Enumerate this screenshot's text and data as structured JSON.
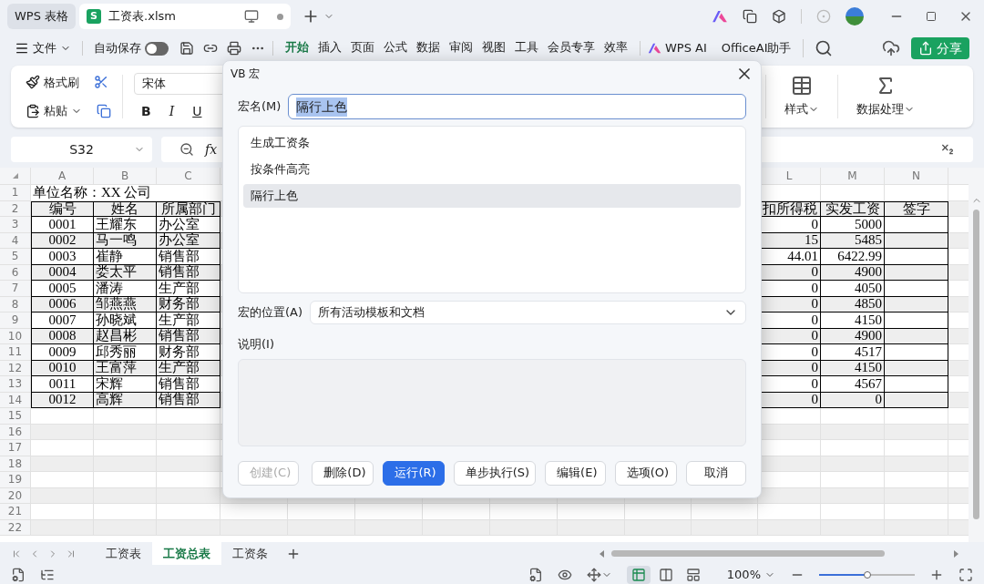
{
  "title_bar": {
    "app_tab": "WPS 表格",
    "document_tab": {
      "icon_letter": "S",
      "title": "工资表.xlsm",
      "selected": true
    }
  },
  "menu_bar": {
    "file_menu": "文件",
    "autosave": {
      "label": "自动保存",
      "on": false
    },
    "tabs": [
      {
        "label": "开始",
        "selected": true
      },
      {
        "label": "插入",
        "selected": false
      },
      {
        "label": "页面",
        "selected": false
      },
      {
        "label": "公式",
        "selected": false
      },
      {
        "label": "数据",
        "selected": false
      },
      {
        "label": "审阅",
        "selected": false
      },
      {
        "label": "视图",
        "selected": false
      },
      {
        "label": "工具",
        "selected": false
      },
      {
        "label": "会员专享",
        "selected": false
      },
      {
        "label": "效率",
        "selected": false
      }
    ],
    "ai_button": "WPS AI",
    "assistant": "OfficeAI助手",
    "share_button": "分享"
  },
  "ribbon": {
    "format_painter": "格式刷",
    "paste": "粘贴",
    "font": "宋体",
    "format_buttons": [
      "B",
      "I",
      "U"
    ],
    "styles": "样式",
    "data_processing": "数据处理"
  },
  "formula_bar": {
    "cell_name": "S32",
    "function_label": "fx"
  },
  "sheet": {
    "columns": [
      {
        "label": "A"
      },
      {
        "label": "B"
      },
      {
        "label": "C"
      },
      {
        "label": "L"
      },
      {
        "label": "M"
      },
      {
        "label": "N"
      }
    ],
    "rows": [
      {
        "number": "1",
        "kind": "title",
        "shaded": false,
        "title": "单位名称：XX 公司"
      },
      {
        "number": "2",
        "kind": "header",
        "shaded": true,
        "a": "编号",
        "b": "姓名",
        "c": "所属部门",
        "l": "扣所得税",
        "m": "实发工资",
        "n": "签字"
      },
      {
        "number": "3",
        "kind": "data",
        "shaded": false,
        "a": "0001",
        "b": "王耀东",
        "c": "办公室",
        "l": "0",
        "m": "5000"
      },
      {
        "number": "4",
        "kind": "data",
        "shaded": true,
        "a": "0002",
        "b": "马一鸣",
        "c": "办公室",
        "l": "15",
        "m": "5485"
      },
      {
        "number": "5",
        "kind": "data",
        "shaded": false,
        "a": "0003",
        "b": "崔静",
        "c": "销售部",
        "l": "44.01",
        "m": "6422.99"
      },
      {
        "number": "6",
        "kind": "data",
        "shaded": true,
        "a": "0004",
        "b": "娄太平",
        "c": "销售部",
        "l": "0",
        "m": "4900"
      },
      {
        "number": "7",
        "kind": "data",
        "shaded": false,
        "a": "0005",
        "b": "潘涛",
        "c": "生产部",
        "l": "0",
        "m": "4050"
      },
      {
        "number": "8",
        "kind": "data",
        "shaded": true,
        "a": "0006",
        "b": "邹燕燕",
        "c": "财务部",
        "l": "0",
        "m": "4850"
      },
      {
        "number": "9",
        "kind": "data",
        "shaded": false,
        "a": "0007",
        "b": "孙晓斌",
        "c": "生产部",
        "l": "0",
        "m": "4150"
      },
      {
        "number": "10",
        "kind": "data",
        "shaded": true,
        "a": "0008",
        "b": "赵昌彬",
        "c": "销售部",
        "l": "0",
        "m": "4900"
      },
      {
        "number": "11",
        "kind": "data",
        "shaded": false,
        "a": "0009",
        "b": "邱秀丽",
        "c": "财务部",
        "l": "0",
        "m": "4517"
      },
      {
        "number": "12",
        "kind": "data",
        "shaded": true,
        "a": "0010",
        "b": "王富萍",
        "c": "生产部",
        "l": "0",
        "m": "4150"
      },
      {
        "number": "13",
        "kind": "data",
        "shaded": false,
        "a": "0011",
        "b": "宋辉",
        "c": "销售部",
        "l": "0",
        "m": "4567"
      },
      {
        "number": "14",
        "kind": "data",
        "shaded": true,
        "a": "0012",
        "b": "高辉",
        "c": "销售部",
        "l": "0",
        "m": "0"
      },
      {
        "number": "15",
        "kind": "empty",
        "shaded": false
      },
      {
        "number": "16",
        "kind": "empty",
        "shaded": true
      },
      {
        "number": "17",
        "kind": "empty",
        "shaded": false
      },
      {
        "number": "18",
        "kind": "empty",
        "shaded": true
      },
      {
        "number": "19",
        "kind": "empty",
        "shaded": false
      },
      {
        "number": "20",
        "kind": "empty",
        "shaded": true
      },
      {
        "number": "21",
        "kind": "empty",
        "shaded": false
      },
      {
        "number": "22",
        "kind": "empty",
        "shaded": true
      }
    ]
  },
  "sheet_tabs": [
    {
      "label": "工资表",
      "selected": false
    },
    {
      "label": "工资总表",
      "selected": true
    },
    {
      "label": "工资条",
      "selected": false
    }
  ],
  "status_bar": {
    "views": [
      {
        "kind": "normal",
        "selected": true
      },
      {
        "kind": "reading",
        "selected": false
      },
      {
        "kind": "page",
        "selected": false
      }
    ],
    "zoom": "100%",
    "zoom_slider": {
      "level": 0.5
    }
  },
  "dialog": {
    "title": "VB 宏",
    "name_label": "宏名(M)",
    "name_value": "隔行上色",
    "macros": [
      {
        "label": "生成工资条",
        "selected": false
      },
      {
        "label": "按条件高亮",
        "selected": false
      },
      {
        "label": "隔行上色",
        "selected": true
      }
    ],
    "location_label": "宏的位置(A)",
    "location_value": "所有活动模板和文档",
    "description_label": "说明(I)",
    "buttons": [
      {
        "label": "创建(C)",
        "kind": "default",
        "disabled": true
      },
      {
        "label": "删除(D)",
        "kind": "default",
        "disabled": false
      },
      {
        "label": "运行(R)",
        "kind": "primary",
        "disabled": false
      },
      {
        "label": "单步执行(S)",
        "kind": "default",
        "disabled": false
      },
      {
        "label": "编辑(E)",
        "kind": "default",
        "disabled": false
      },
      {
        "label": "选项(O)",
        "kind": "default",
        "disabled": false
      },
      {
        "label": "取消",
        "kind": "default",
        "disabled": false
      }
    ]
  }
}
